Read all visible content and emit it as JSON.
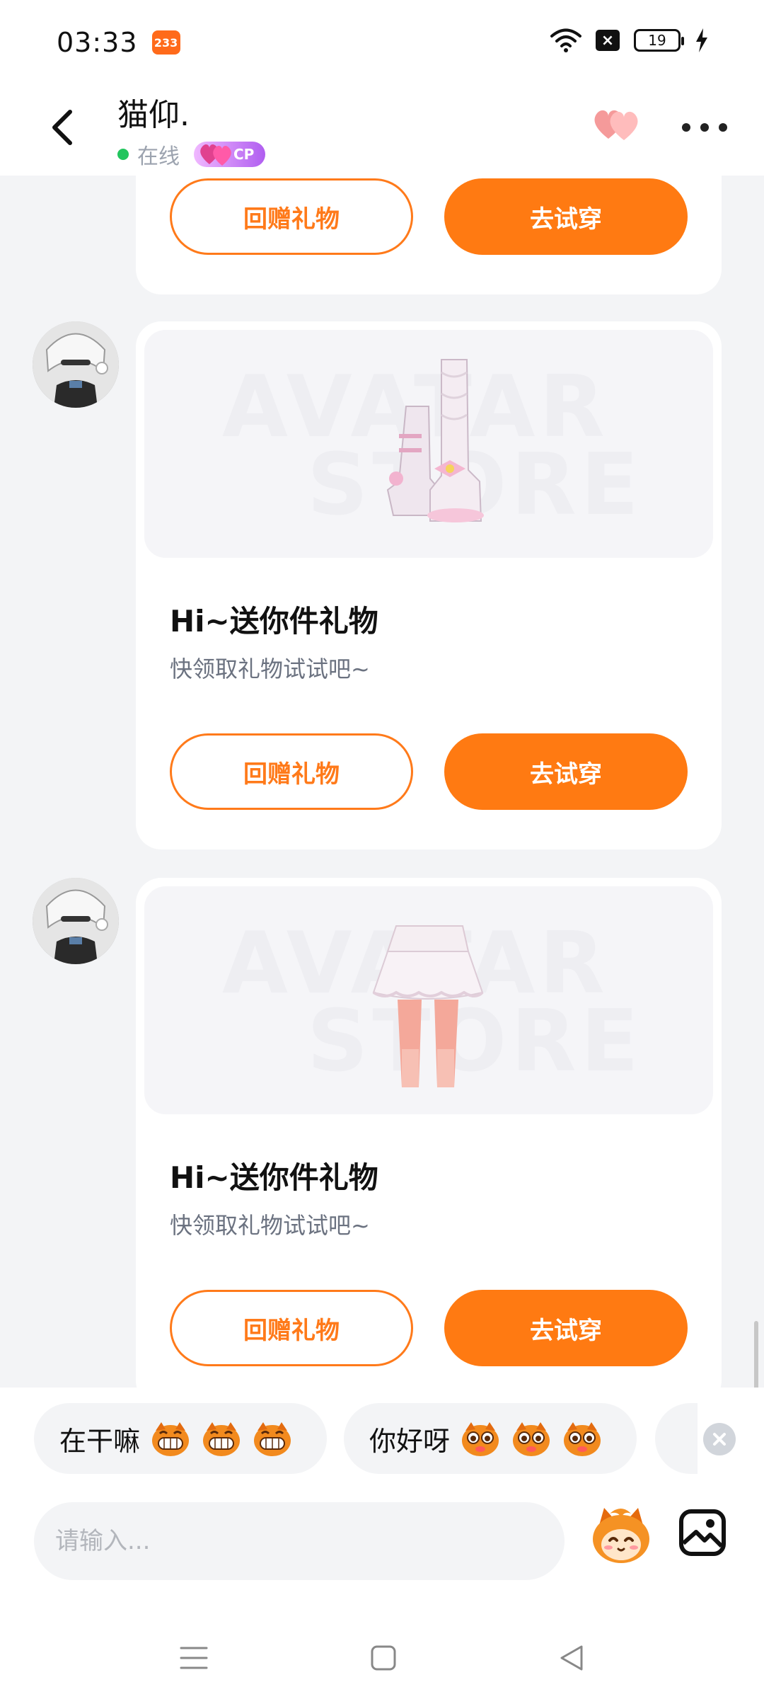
{
  "status_bar": {
    "time": "03:33",
    "app_badge": "233",
    "battery": "19"
  },
  "header": {
    "contact_name": "猫仰.",
    "status": "在线",
    "cp_label": "CP"
  },
  "chat": {
    "watermark_line1": "AVATAR",
    "watermark_line2": "STORE",
    "messages": [
      {
        "title": "",
        "subtitle": "",
        "return_label": "回赠礼物",
        "try_label": "去试穿"
      },
      {
        "title": "Hi~送你件礼物",
        "subtitle": "快领取礼物试试吧~",
        "return_label": "回赠礼物",
        "try_label": "去试穿",
        "item": "boots"
      },
      {
        "title": "Hi~送你件礼物",
        "subtitle": "快领取礼物试试吧~",
        "return_label": "回赠礼物",
        "try_label": "去试穿",
        "item": "skirt"
      }
    ]
  },
  "quick_replies": [
    {
      "text": "在干嘛"
    },
    {
      "text": "你好呀"
    }
  ],
  "input": {
    "placeholder": "请输入..."
  },
  "colors": {
    "accent": "#ff7a12",
    "background": "#f3f4f6",
    "online": "#22c55e"
  },
  "icons": {
    "back": "chevron-left-icon",
    "hearts": "hearts-icon",
    "more": "more-horizontal-icon",
    "emoji": "emoji-icon",
    "image": "image-icon",
    "close": "close-icon"
  }
}
